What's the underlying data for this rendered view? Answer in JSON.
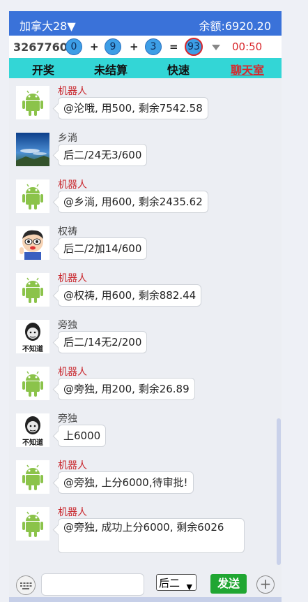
{
  "header": {
    "title": "加拿大28▼",
    "balance": "余额:6920.20"
  },
  "draw": {
    "issue": "3267760",
    "balls": [
      "0",
      "9",
      "3"
    ],
    "ops": [
      "+",
      "+",
      "="
    ],
    "sum": "93",
    "timer": "00:50"
  },
  "tabs": [
    {
      "label": "开奖"
    },
    {
      "label": "未结算"
    },
    {
      "label": "快速"
    },
    {
      "label": "聊天室"
    }
  ],
  "messages": [
    {
      "name": "机器人",
      "text": "@沦哦, 用500, 剩余7542.58",
      "avatar": "android-icon"
    },
    {
      "name": "乡淌",
      "text": "后二/24无3/600",
      "avatar": "sky-photo"
    },
    {
      "name": "机器人",
      "text": "@乡淌, 用600, 剩余2435.62",
      "avatar": "android-icon"
    },
    {
      "name": "权祷",
      "text": "后二/2加14/600",
      "avatar": "cartoon-face"
    },
    {
      "name": "机器人",
      "text": "@权祷, 用600, 剩余882.44",
      "avatar": "android-icon"
    },
    {
      "name": "旁独",
      "text": "后二/14无2/200",
      "avatar": "meme-face",
      "avatar_caption": "不知道"
    },
    {
      "name": "机器人",
      "text": "@旁独, 用200, 剩余26.89",
      "avatar": "android-icon"
    },
    {
      "name": "旁独",
      "text": "上6000",
      "avatar": "meme-face",
      "avatar_caption": "不知道"
    },
    {
      "name": "机器人",
      "text": "@旁独, 上分6000,待审批!",
      "avatar": "android-icon"
    },
    {
      "name": "机器人",
      "text": "@旁独, 成功上分6000, 剩余6026",
      "avatar": "android-icon"
    }
  ],
  "inputbar": {
    "select_value": "后二",
    "send_label": "发送"
  },
  "colors": {
    "header": "#3a72d9",
    "tabs": "#33d6d6",
    "bot_name": "#c9252b",
    "send": "#20a632",
    "timer": "#d8262b"
  }
}
